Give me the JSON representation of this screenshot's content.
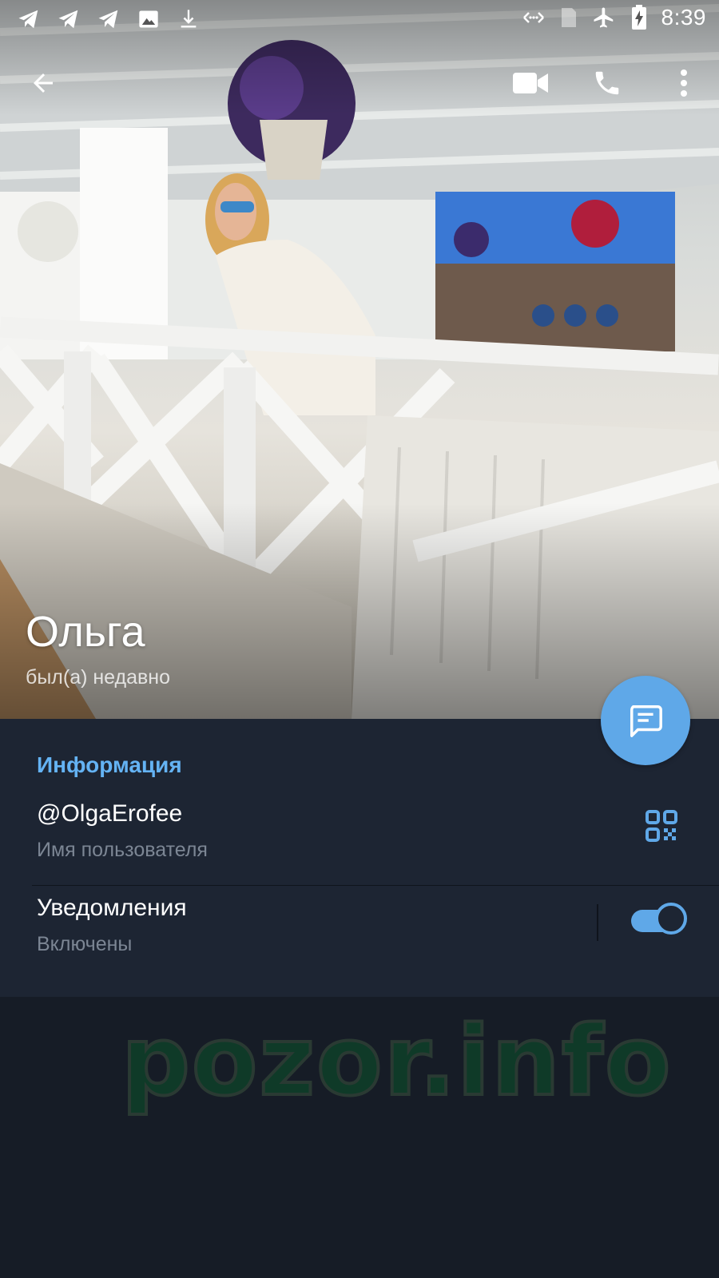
{
  "status_bar": {
    "time": "8:39",
    "left_icons": [
      "telegram-icon",
      "telegram-icon",
      "telegram-icon",
      "image-icon",
      "download-icon"
    ],
    "right_icons": [
      "data-saver-icon",
      "no-sim-icon",
      "airplane-mode-icon",
      "battery-charging-icon"
    ]
  },
  "app_bar": {
    "icons": [
      "back-arrow-icon",
      "video-call-icon",
      "phone-call-icon",
      "more-vert-icon"
    ]
  },
  "profile": {
    "name": "Ольга",
    "status": "был(а) недавно"
  },
  "fab": {
    "icon": "message-icon"
  },
  "info": {
    "section_title": "Информация",
    "username": {
      "value": "@OlgaErofee",
      "label": "Имя пользователя"
    },
    "notifications": {
      "title": "Уведомления",
      "state": "Включены",
      "enabled": true
    }
  },
  "watermark": "pozor.info",
  "colors": {
    "accent": "#5fa8e8",
    "section_title": "#64b3f4",
    "panel_bg": "#1d2533",
    "page_bg": "#161c26"
  }
}
